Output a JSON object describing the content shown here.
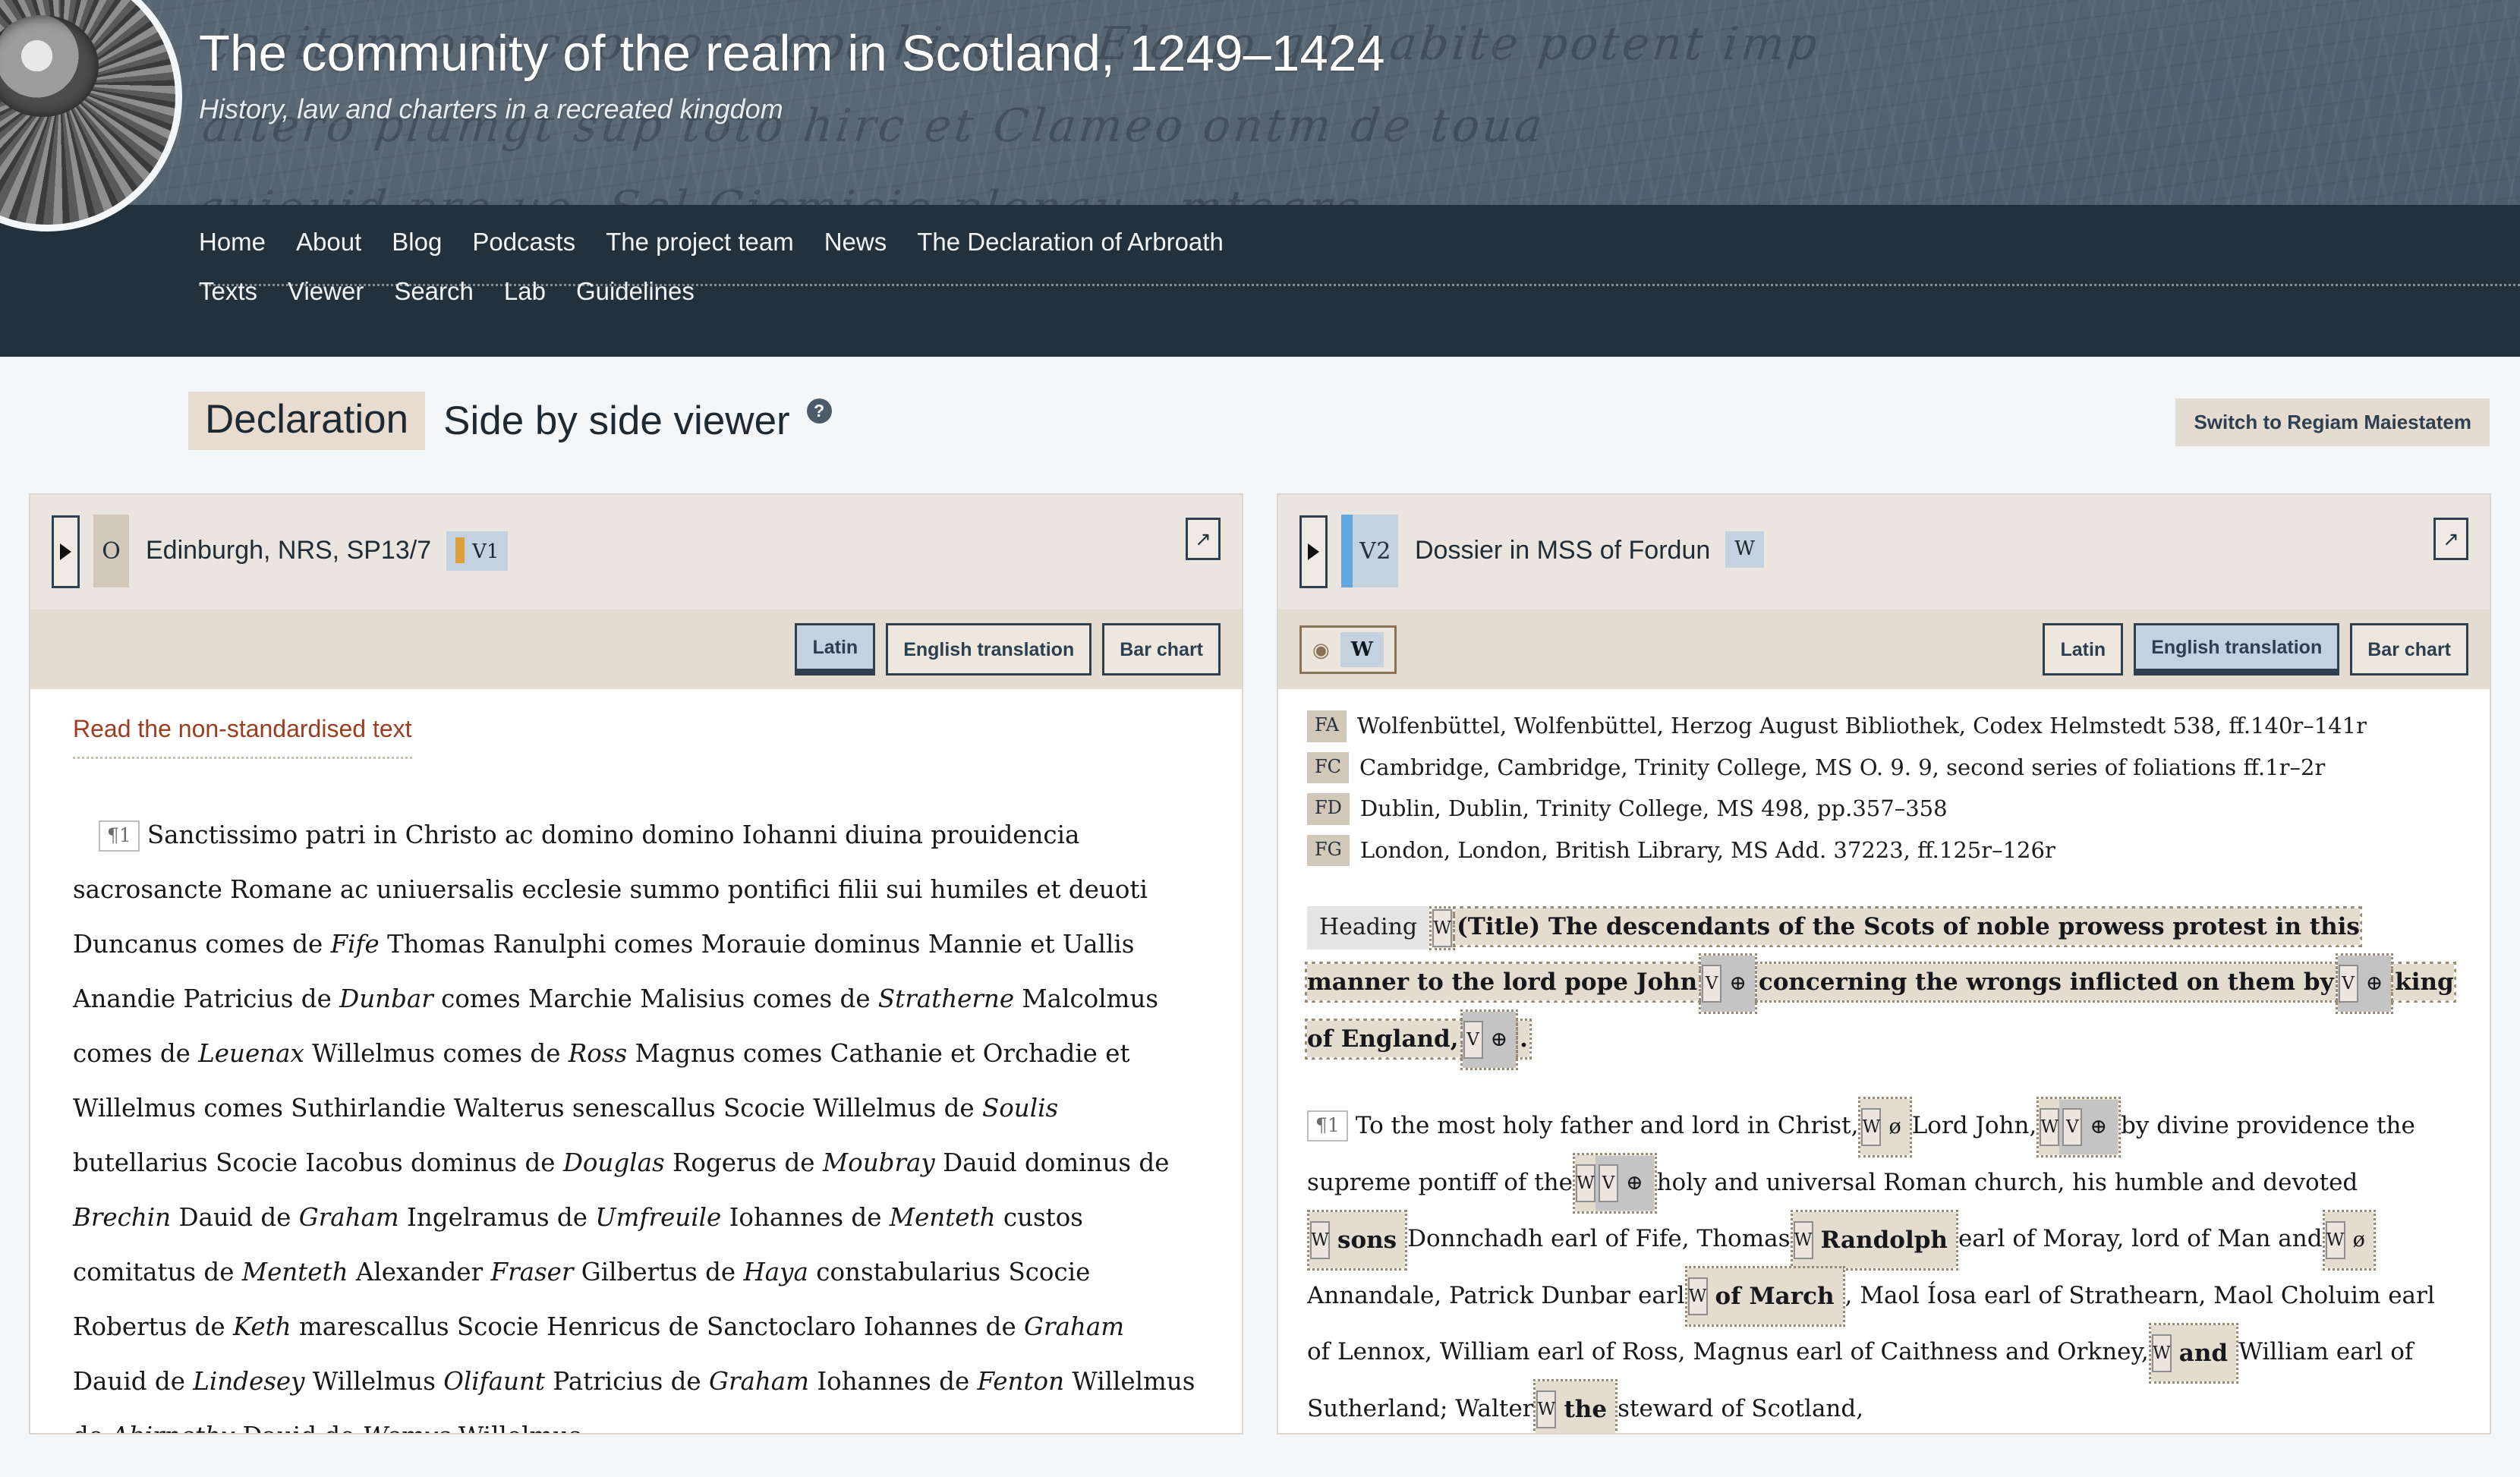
{
  "site": {
    "title": "The community of the realm in Scotland, 1249–1424",
    "subtitle": "History, law and charters in a recreated kingdom",
    "script_bg_line1": "tegitam ons cap non copa hive ac Elamo quod habite potent imp",
    "script_bg_line2": "altero plumge sup toto hirc et Clameo",
    "nav_primary": [
      "Home",
      "About",
      "Blog",
      "Podcasts",
      "The project team",
      "News",
      "The Declaration of Arbroath"
    ],
    "nav_secondary": [
      "Texts",
      "Viewer",
      "Search",
      "Lab",
      "Guidelines"
    ]
  },
  "page": {
    "tag": "Declaration",
    "title": "Side by side viewer",
    "help_icon": "?",
    "switch_button": "Switch to Regiam Maiestatem"
  },
  "left_panel": {
    "caret_icon": "caret-right-icon",
    "siglum": "O",
    "title": "Edinburgh, NRS, SP13/7",
    "version_chip": "V1",
    "expand_icon": "↗",
    "buttons": [
      {
        "label": "Latin",
        "active": true
      },
      {
        "label": "English translation",
        "active": false
      },
      {
        "label": "Bar chart",
        "active": false
      }
    ],
    "nonstandard_link": "Read the non-standardised text",
    "paragraph_mark": "¶1",
    "latin_segments": [
      {
        "t": "Sanctissimo patri in Christo ac domino domino Iohanni diuina prouidencia sacrosancte Romane ac uniuersalis ecclesie summo pontifici filii sui humiles et deuoti Duncanus comes de ",
        "i": false
      },
      {
        "t": "Fife",
        "i": true
      },
      {
        "t": " Thomas Ranulphi comes Morauie dominus Mannie et Uallis Anandie Patricius de ",
        "i": false
      },
      {
        "t": "Dunbar",
        "i": true
      },
      {
        "t": " comes Marchie Malisius comes de ",
        "i": false
      },
      {
        "t": "Stratherne",
        "i": true
      },
      {
        "t": " Malcolmus comes de ",
        "i": false
      },
      {
        "t": "Leuenax",
        "i": true
      },
      {
        "t": " Willelmus comes de ",
        "i": false
      },
      {
        "t": "Ross",
        "i": true
      },
      {
        "t": " Magnus comes Cathanie et Orchadie et Willelmus comes Suthirlandie Walterus senescallus Scocie Willelmus de ",
        "i": false
      },
      {
        "t": "Soulis",
        "i": true
      },
      {
        "t": " butellarius Scocie Iacobus dominus de ",
        "i": false
      },
      {
        "t": "Douglas",
        "i": true
      },
      {
        "t": " Rogerus de ",
        "i": false
      },
      {
        "t": "Moubray",
        "i": true
      },
      {
        "t": " Dauid dominus de ",
        "i": false
      },
      {
        "t": "Brechin",
        "i": true
      },
      {
        "t": " Dauid de ",
        "i": false
      },
      {
        "t": "Graham",
        "i": true
      },
      {
        "t": " Ingelramus de ",
        "i": false
      },
      {
        "t": "Umfreuile",
        "i": true
      },
      {
        "t": " Iohannes de ",
        "i": false
      },
      {
        "t": "Menteth",
        "i": true
      },
      {
        "t": " custos comitatus de ",
        "i": false
      },
      {
        "t": "Menteth",
        "i": true
      },
      {
        "t": " Alexander ",
        "i": false
      },
      {
        "t": "Fraser",
        "i": true
      },
      {
        "t": " Gilbertus de ",
        "i": false
      },
      {
        "t": "Haya",
        "i": true
      },
      {
        "t": " constabularius Scocie Robertus de ",
        "i": false
      },
      {
        "t": "Keth",
        "i": true
      },
      {
        "t": " marescallus Scocie Henricus de Sanctoclaro Iohannes de ",
        "i": false
      },
      {
        "t": "Graham",
        "i": true
      },
      {
        "t": " Dauid de ",
        "i": false
      },
      {
        "t": "Lindesey",
        "i": true
      },
      {
        "t": " Willelmus ",
        "i": false
      },
      {
        "t": "Olifaunt",
        "i": true
      },
      {
        "t": " Patricius de ",
        "i": false
      },
      {
        "t": "Graham",
        "i": true
      },
      {
        "t": " Iohannes de ",
        "i": false
      },
      {
        "t": "Fenton",
        "i": true
      },
      {
        "t": " Willelmus de ",
        "i": false
      },
      {
        "t": "Abirnethy",
        "i": true
      },
      {
        "t": " Dauid de ",
        "i": false
      },
      {
        "t": "Wemys",
        "i": true
      },
      {
        "t": " Willelmus",
        "i": false
      }
    ]
  },
  "right_panel": {
    "caret_icon": "caret-right-icon",
    "siglum": "V2",
    "title": "Dossier in MSS of Fordun",
    "version_chip": "W",
    "expand_icon": "↗",
    "eye_icon": "◉",
    "eye_chip": "W",
    "buttons": [
      {
        "label": "Latin",
        "active": false
      },
      {
        "label": "English translation",
        "active": true
      },
      {
        "label": "Bar chart",
        "active": false
      }
    ],
    "manuscripts": [
      {
        "sig": "FA",
        "text": "Wolfenbüttel, Wolfenbüttel, Herzog August Bibliothek, Codex Helmstedt 538, ff.140r–141r"
      },
      {
        "sig": "FC",
        "text": "Cambridge, Cambridge, Trinity College, MS O. 9. 9, second series of foliations ff.1r–2r"
      },
      {
        "sig": "FD",
        "text": "Dublin, Dublin, Trinity College, MS 498, pp.357–358"
      },
      {
        "sig": "FG",
        "text": "London, London, British Library, MS Add. 37223, ff.125r–126r"
      }
    ],
    "heading_label": "Heading",
    "heading_marker": "W",
    "heading_part1": "(Title) The descendants of the Scots of noble prowess protest in this manner to the lord pope John",
    "heading_part2": "concerning the wrongs inflicted on them by",
    "heading_part3": "king of England,",
    "heading_end": ".",
    "paragraph_mark": "¶1",
    "para_p1": "To the most holy father and lord in Christ,",
    "para_p2": "Lord John,",
    "para_p3": "by divine providence the supreme pontiff of the",
    "para_p4": "holy and universal Roman church, his humble and devoted",
    "para_p5": "Donnchadh earl of Fife, Thomas",
    "para_p6": "earl of Moray, lord of Man and",
    "para_p7": "Annandale, Patrick Dunbar earl",
    "para_p8": ", Maol Íosa earl of Strathearn, Maol Choluim earl of Lennox, William earl of Ross, Magnus earl of Caithness and Orkney,",
    "para_p9": "William earl of Sutherland; Walter",
    "para_p10": "steward of Scotland,",
    "marker_w": "W",
    "marker_v": "V",
    "sym_empty": "ø",
    "sym_circle": "⊕",
    "word_sons": "sons",
    "word_randolph": "Randolph",
    "word_of_march": "of March",
    "word_and": "and",
    "word_the": "the"
  },
  "colors": {
    "header_bg": "#4e5e6e",
    "nav_bg": "#22313c",
    "accent_orange": "#dda03a",
    "accent_blue": "#62a8de",
    "chip_blue": "#c3d2de",
    "tag_beige": "#e7dccf",
    "toolbar_beige": "#e4dbd1",
    "panel_head": "#eae5df",
    "link_rust": "#9c3d20",
    "highlight": "#e5dcd0"
  }
}
